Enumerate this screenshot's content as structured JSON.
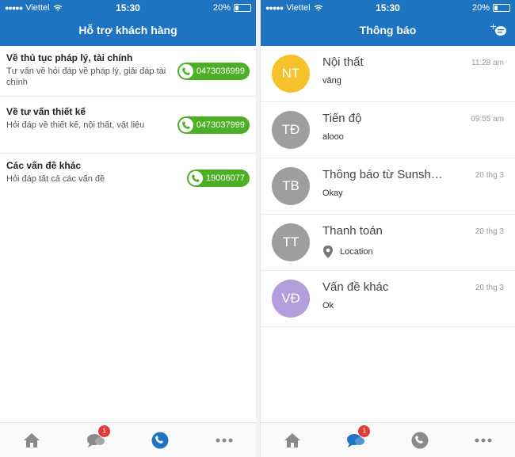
{
  "status": {
    "carrier": "Viettel",
    "time": "15:30",
    "battery": "20%"
  },
  "support": {
    "title": "Hỗ trợ khách hàng",
    "items": [
      {
        "heading": "Về thủ tục pháp lý, tài chính",
        "desc": "Tư vấn về hỏi đáp về pháp lý, giải đáp tài chính",
        "phone": "0473036999"
      },
      {
        "heading": "Về tư vấn thiết kế",
        "desc": "Hỏi đáp về thiết kế, nội thất, vật liệu",
        "phone": "0473037999"
      },
      {
        "heading": "Các vấn đề khác",
        "desc": "Hỏi đáp tất cả các vấn đề",
        "phone": "19006077"
      }
    ]
  },
  "notifications": {
    "title": "Thông báo",
    "items": [
      {
        "initials": "NT",
        "name": "Nội thất",
        "time": "11:28 am",
        "message": "vâng",
        "color": "#f6c22c",
        "icon": ""
      },
      {
        "initials": "TĐ",
        "name": "Tiến độ",
        "time": "09:55 am",
        "message": "alooo",
        "color": "#9e9e9e",
        "icon": ""
      },
      {
        "initials": "TB",
        "name": "Thông báo từ Sunsh…",
        "time": "20 thg 3",
        "message": "Okay",
        "color": "#9e9e9e",
        "icon": ""
      },
      {
        "initials": "TT",
        "name": "Thanh toán",
        "time": "20 thg 3",
        "message": "Location",
        "color": "#9e9e9e",
        "icon": "location-pin-icon"
      },
      {
        "initials": "VĐ",
        "name": "Vấn đề khác",
        "time": "20 thg 3",
        "message": "Ok",
        "color": "#b39ddb",
        "icon": ""
      }
    ]
  },
  "tabbar": {
    "badge_count": "1",
    "accent": "#1f74c1"
  }
}
